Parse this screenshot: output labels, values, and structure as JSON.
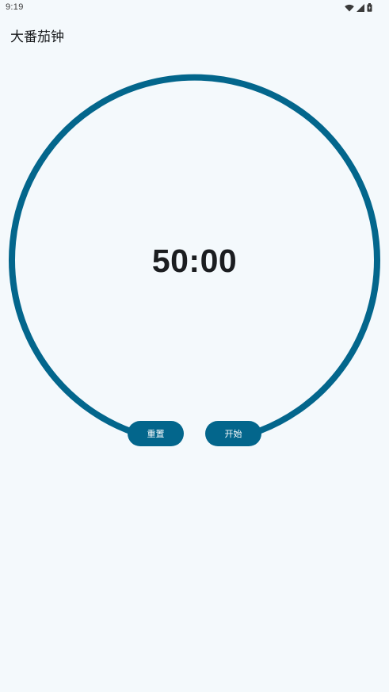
{
  "status_bar": {
    "time": "9:19",
    "icons": [
      "wifi-icon",
      "cellular-signal-icon",
      "battery-icon"
    ]
  },
  "app": {
    "title": "大番茄钟"
  },
  "timer": {
    "display": "50:00"
  },
  "controls": {
    "reset_label": "重置",
    "start_label": "开始"
  },
  "colors": {
    "background": "#f4f9fc",
    "accent": "#03668c",
    "text": "#1b1d20"
  }
}
